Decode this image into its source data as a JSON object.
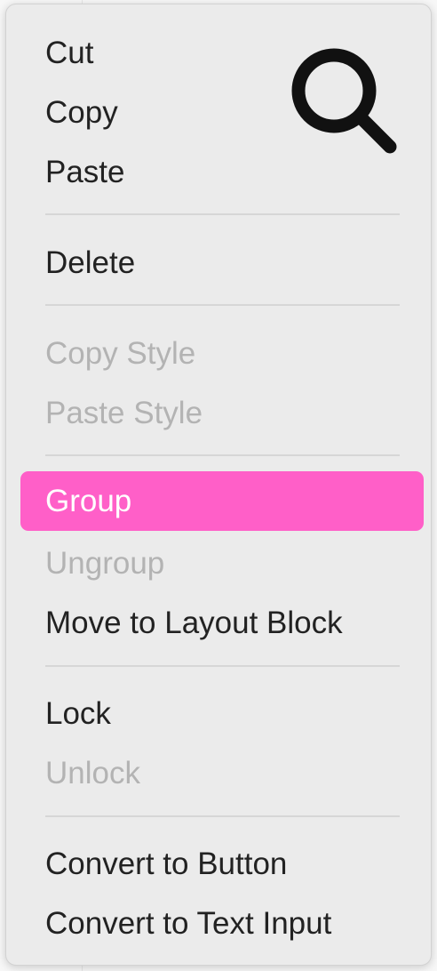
{
  "menu": {
    "items": {
      "cut": "Cut",
      "copy": "Copy",
      "paste": "Paste",
      "delete": "Delete",
      "copy_style": "Copy Style",
      "paste_style": "Paste Style",
      "group": "Group",
      "ungroup": "Ungroup",
      "move_to_layout_block": "Move to Layout Block",
      "lock": "Lock",
      "unlock": "Unlock",
      "convert_to_button": "Convert to Button",
      "convert_to_text_input": "Convert to Text Input"
    },
    "disabled_items": [
      "copy_style",
      "paste_style",
      "ungroup",
      "unlock"
    ],
    "highlighted_item": "group",
    "highlight_color": "#ff5fc8",
    "overlay_icon": "search-icon"
  }
}
